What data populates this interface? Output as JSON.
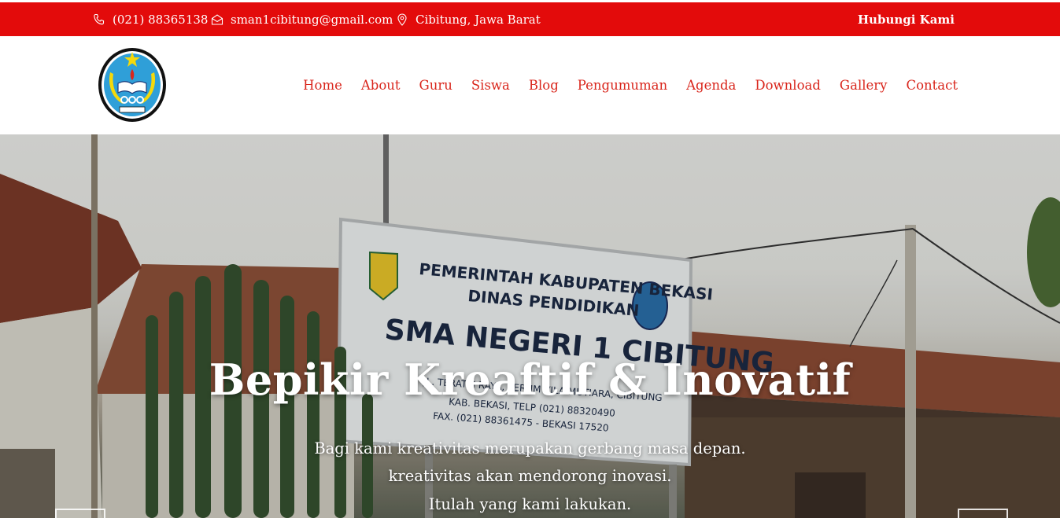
{
  "topbar": {
    "phone": "(021) 88365138",
    "email": "sman1cibitung@gmail.com",
    "location": "Cibitung, Jawa Barat",
    "contact_label": "Hubungi Kami"
  },
  "nav": {
    "items": [
      "Home",
      "About",
      "Guru",
      "Siswa",
      "Blog",
      "Pengumuman",
      "Agenda",
      "Download",
      "Gallery",
      "Contact"
    ]
  },
  "hero": {
    "title": "Bepikir Kreaftif & Inovatif",
    "line1": "Bagi kami kreativitas merupakan gerbang masa depan.",
    "line2": "kreativitas akan mendorong inovasi.",
    "line3": "Itulah yang kami lakukan.",
    "sign": {
      "line1": "PEMERINTAH KABUPATEN BEKASI",
      "line2": "DINAS PENDIDIKAN",
      "line3": "SMA NEGERI 1 CIBITUNG",
      "line4": "JL. TERATAI RAYA, PERUM VILA MUTIARA, CIBITUNG",
      "line5": "KAB. BEKASI, TELP (021) 88320490",
      "line6": "FAX. (021) 88361475 - BEKASI 17520"
    }
  },
  "colors": {
    "topbar_bg": "#e30b0b",
    "nav_link": "#d9261c",
    "text_on_red": "#ffffff"
  },
  "icons": {
    "phone": "phone-icon",
    "email": "envelope-icon",
    "location": "map-pin-icon"
  }
}
